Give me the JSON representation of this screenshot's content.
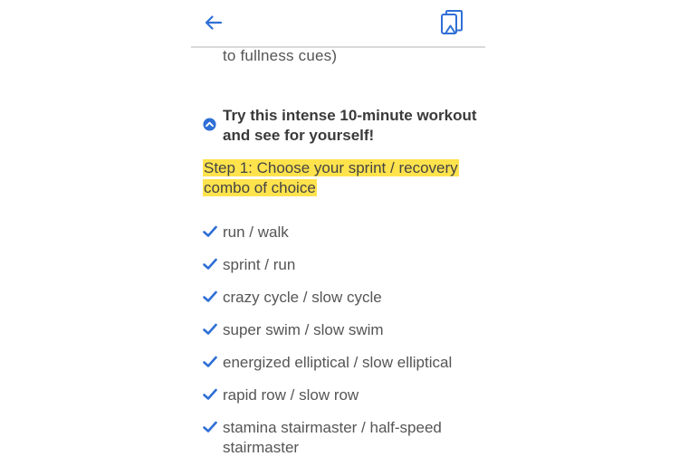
{
  "header": {
    "back_icon": "arrow-left-icon",
    "bookmark_icon": "bookmark-book-icon",
    "accent_color": "#2f6fd6"
  },
  "article": {
    "cut_off_line": "to fullness cues)",
    "section_title": "Try this intense 10-minute workout and see for yourself!",
    "step_text": "Step 1: Choose your sprint / recovery combo of choice",
    "highlight_color": "#ffe34d",
    "combos": [
      "run / walk",
      "sprint / run",
      "crazy cycle / slow cycle",
      "super swim / slow swim",
      "energized elliptical / slow elliptical",
      "rapid row / slow row",
      "stamina stairmaster / half-speed stairmaster"
    ]
  }
}
